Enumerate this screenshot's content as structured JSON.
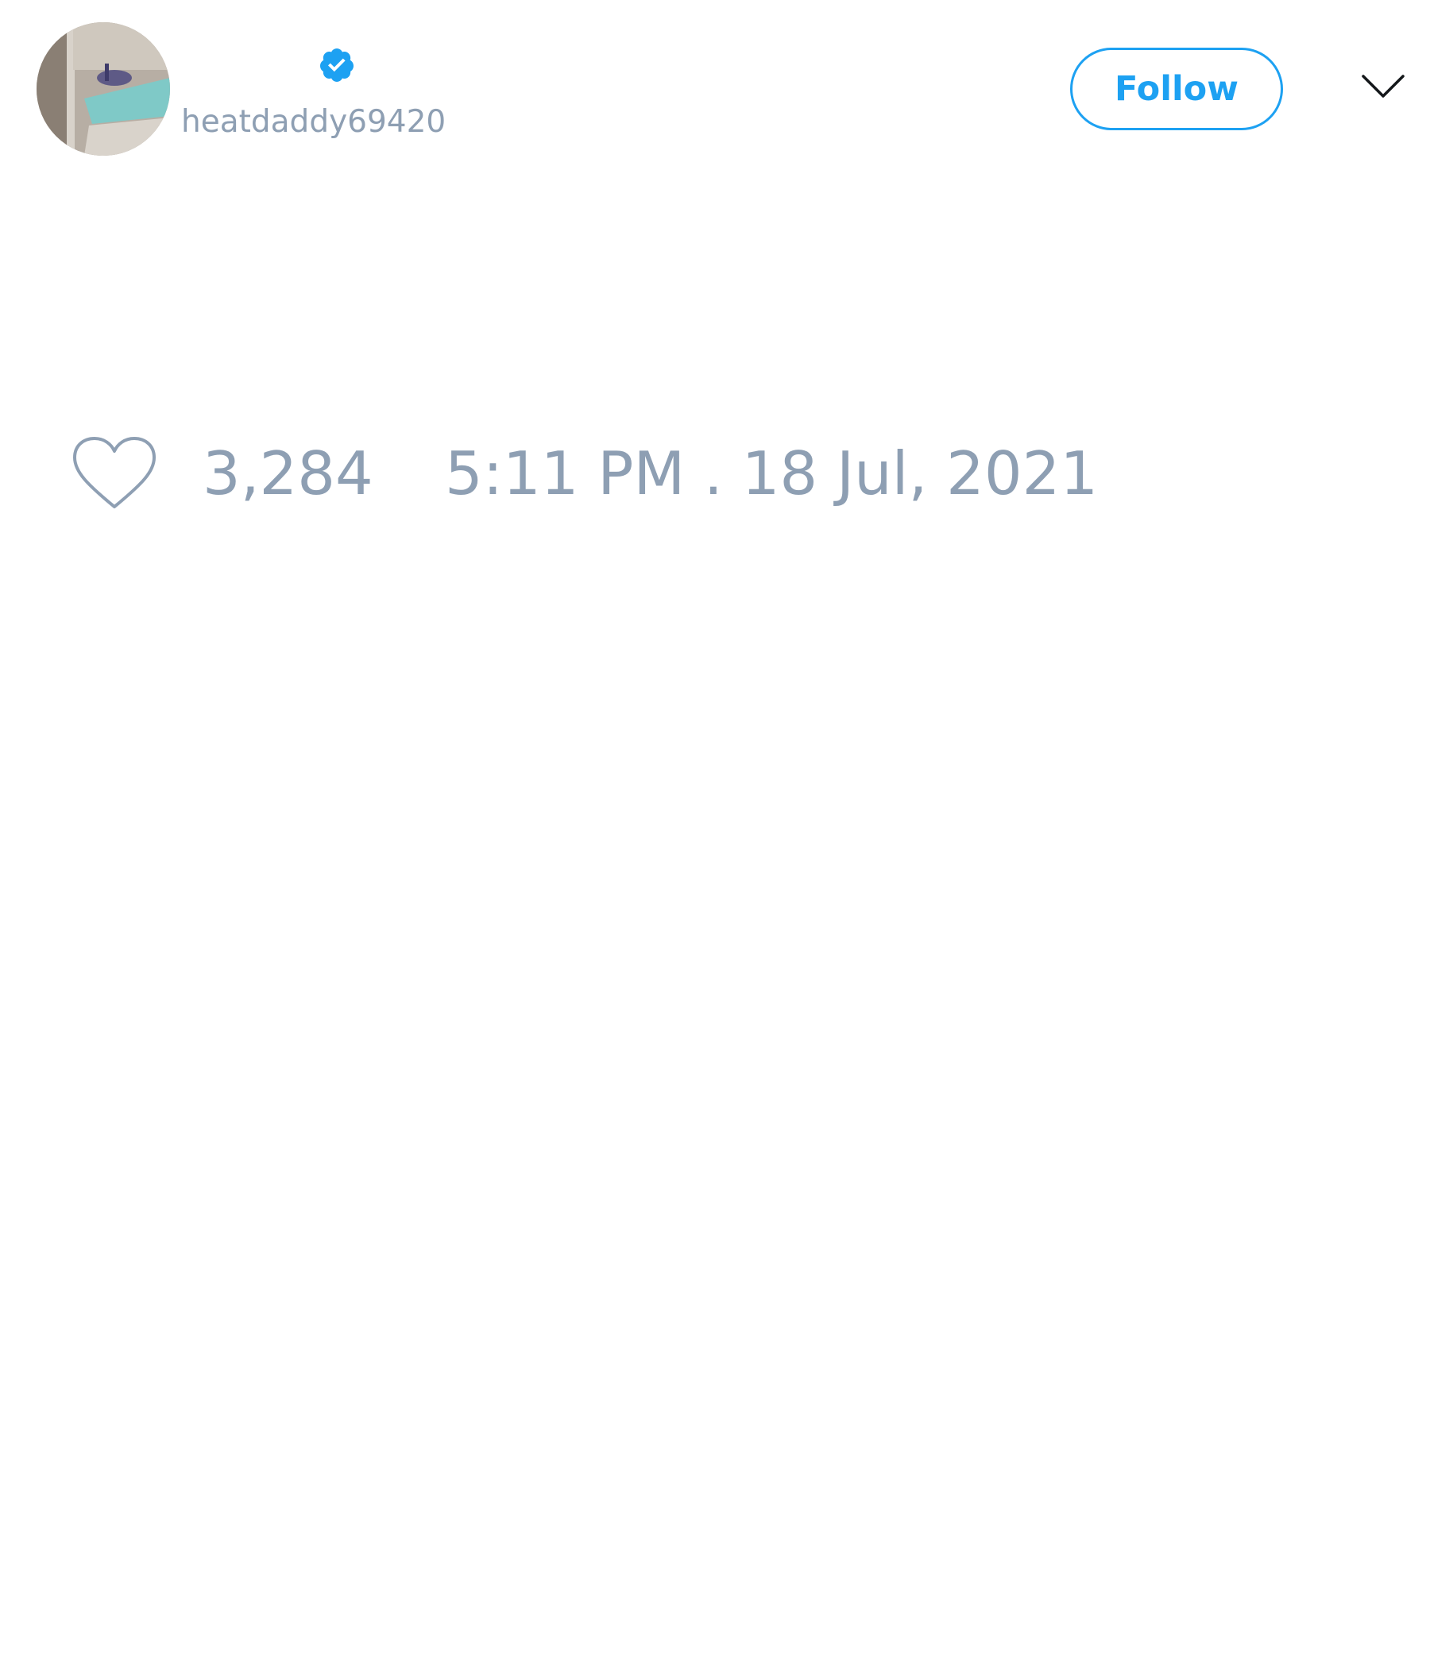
{
  "author": {
    "display_name": "",
    "handle": "heatdaddy69420",
    "verified": true,
    "avatar_icon": "profile-photo"
  },
  "actions": {
    "follow_label": "Follow",
    "menu_icon": "chevron-down-icon"
  },
  "stats": {
    "like_icon": "heart-outline-icon",
    "likes": "3,284",
    "timestamp": "5:11 PM . 18 Jul, 2021"
  },
  "colors": {
    "accent": "#1da1f2",
    "muted_text": "#8e9fb3",
    "background": "#ffffff"
  }
}
